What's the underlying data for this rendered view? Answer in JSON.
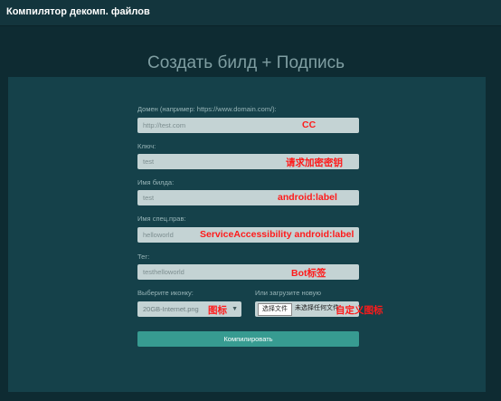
{
  "app": {
    "title": "Компилятор декомп. файлов"
  },
  "page": {
    "title": "Создать билд + Подпись"
  },
  "form": {
    "domain": {
      "label": "Домен (например: https://www.domain.com/):",
      "value": "http://test.com",
      "annotation": "CC"
    },
    "key": {
      "label": "Ключ:",
      "value": "test",
      "annotation": "请求加密密钥"
    },
    "build_name": {
      "label": "Имя билда:",
      "value": "test",
      "annotation": "android:label"
    },
    "special_rights": {
      "label": "Имя спец.прав:",
      "value": "helloworld",
      "annotation": "ServiceAccessibility android:label"
    },
    "tag": {
      "label": "Тег:",
      "value": "testhelloworld",
      "annotation": "Bot标签"
    },
    "icon_select": {
      "label": "Выберите иконку:",
      "value": "20GB-Internet.png",
      "annotation": "图标"
    },
    "icon_upload": {
      "label": "Или загрузите новую",
      "button": "选择文件",
      "status": "未选择任何文件",
      "annotation": "自定义图标"
    },
    "submit": {
      "label": "Компилировать"
    }
  },
  "colors": {
    "background": "#0e2b32",
    "panel": "#15414a",
    "input": "#c4d3d4",
    "button": "#379b91",
    "annotation": "#ff1a1a"
  },
  "icons": {
    "select_arrow": "chevron-down-icon"
  }
}
